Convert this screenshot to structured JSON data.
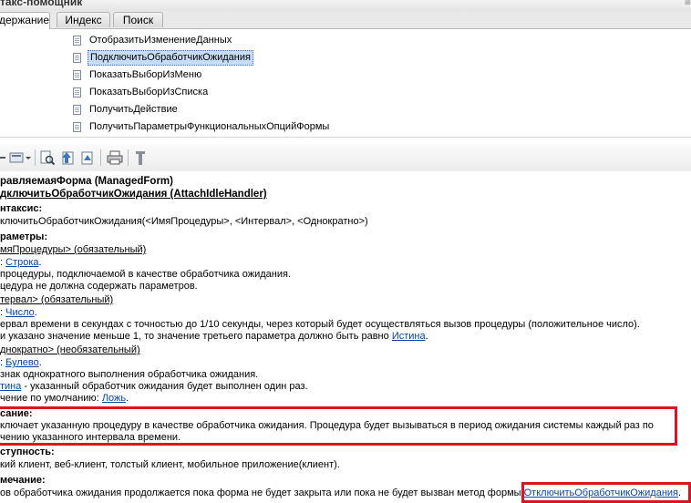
{
  "window": {
    "title": "такс-помощник",
    "win_button": "≡"
  },
  "tabs": [
    {
      "label": "держание"
    },
    {
      "label": "Индекс"
    },
    {
      "label": "Поиск"
    }
  ],
  "tree_items": [
    {
      "label": "ОтобразитьИзменениеДанных"
    },
    {
      "label": "ПодключитьОбработчикОжидания"
    },
    {
      "label": "ПоказатьВыборИзМеню"
    },
    {
      "label": "ПоказатьВыборИзСписка"
    },
    {
      "label": "ПолучитьДействие"
    },
    {
      "label": "ПолучитьПараметрыФункциональныхОпцийФормы"
    }
  ],
  "toolbar": {
    "icons": [
      "back-icon",
      "dropdown-arrow-icon",
      "find-icon",
      "up-icon",
      "sync-icon",
      "print-icon",
      "settings-icon"
    ]
  },
  "content": {
    "header_object": "равляемаяФорма (ManagedForm)",
    "header_method": "дключитьОбработчикОжидания (AttachIdleHandler)",
    "syntax_title": "нтаксис:",
    "syntax_text": "ключитьОбработчикОжидания(<ИмяПроцедуры>, <Интервал>, <Однократно>)",
    "params_title": "раметры:",
    "p1_name": "мяПроцедуры> (обязательный)",
    "p1_type_prefix": ":",
    "p1_type_link": "Строка",
    "p1_type_suffix": ".",
    "p1_desc1": "процедуры, подключаемой в качестве обработчика ожидания.",
    "p1_desc2": "цедура не должна содержать параметров.",
    "p2_name": "тервал> (обязательный)",
    "p2_type_prefix": ":",
    "p2_type_link": "Число",
    "p2_type_suffix": ".",
    "p2_desc1": "ервал времени в секундах с точностью до 1/10 секунды, через который будет осуществляться вызов процедуры (положительное число).",
    "p2_desc2_prefix": "и указано значение меньше 1, то значение третьего параметра должно быть равно",
    "p2_desc2_link": "Истина",
    "p2_desc2_suffix": ".",
    "p3_name": "днократно> (необязательный)",
    "p3_type_prefix": ":",
    "p3_type_link": "Булево",
    "p3_type_suffix": ".",
    "p3_desc1": "знак однократного выполнения обработчика ожидания.",
    "p3_desc2_link": "тина",
    "p3_desc2_suffix": " - указанный обработчик ожидания будет выполнен один раз.",
    "p3_default_prefix": "чение по умолчанию:",
    "p3_default_link": "Ложь",
    "p3_default_suffix": ".",
    "desc_title": "сание:",
    "desc_text1": "ключает указанную процедуру в качестве обработчика ожидания. Процедура будет вызываться в период ожидания системы каждый раз по",
    "desc_text2": "чению указанного интервала времени.",
    "avail_title": "ступность:",
    "avail_text": "кий клиент, веб-клиент, толстый клиент, мобильное приложение(клиент).",
    "note_title": "мечание:",
    "note_text_prefix": "ов обработчика ожидания продолжается пока форма не будет закрыта или пока не будет вызван метод формы",
    "note_link": "ОтключитьОбработчикОжидания",
    "note_suffix": "."
  },
  "colors": {
    "highlight_box": "#e0121f",
    "link": "#0645ad",
    "selection": "#c7dcf7"
  }
}
